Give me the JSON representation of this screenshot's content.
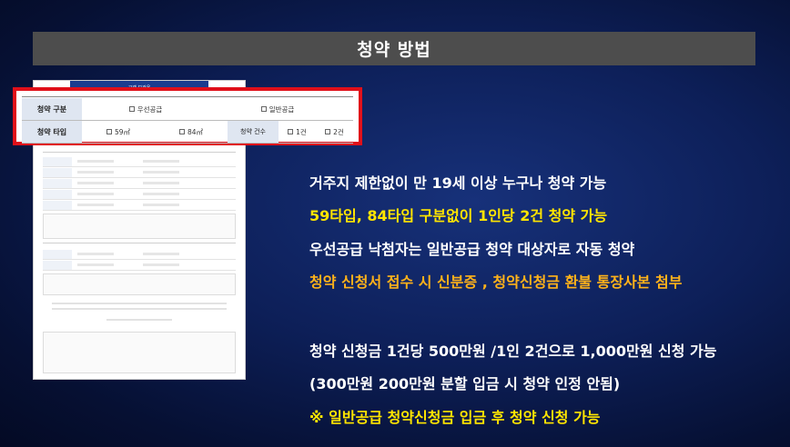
{
  "header": {
    "title": "청약 방법"
  },
  "form_thumbnail": {
    "header_label": "고객 보관용"
  },
  "highlight_table": {
    "row1": {
      "label": "청약 구분",
      "options": [
        "우선공급",
        "일반공급"
      ]
    },
    "row2": {
      "label": "청약 타입",
      "options": [
        "59㎡",
        "84㎡"
      ],
      "sub_label": "청약 건수",
      "count_options": [
        "1건",
        "2건"
      ]
    }
  },
  "info_lines": [
    {
      "text": "거주지 제한없이 만 19세 이상 누구나 청약 가능",
      "color": "#ffffff"
    },
    {
      "text": "59타입, 84타입 구분없이 1인당 2건 청약 가능",
      "color": "#ffe500"
    },
    {
      "text": "우선공급 낙첨자는 일반공급 청약 대상자로 자동 청약",
      "color": "#ffffff"
    },
    {
      "text": "청약 신청서 접수 시 신분증 , 청약신청금 환불 통장사본 첨부",
      "color": "#ffb21a"
    },
    {
      "text": "청약 신청금 1건당 500만원 /1인 2건으로 1,000만원 신청 가능",
      "color": "#ffffff"
    },
    {
      "text": "(300만원 200만원 분할 입금 시 청약 인정 안됨)",
      "color": "#ffffff"
    },
    {
      "text": "※ 일반공급 청약신청금 입금 후 청약 신청 가능",
      "color": "#ffe500"
    }
  ]
}
